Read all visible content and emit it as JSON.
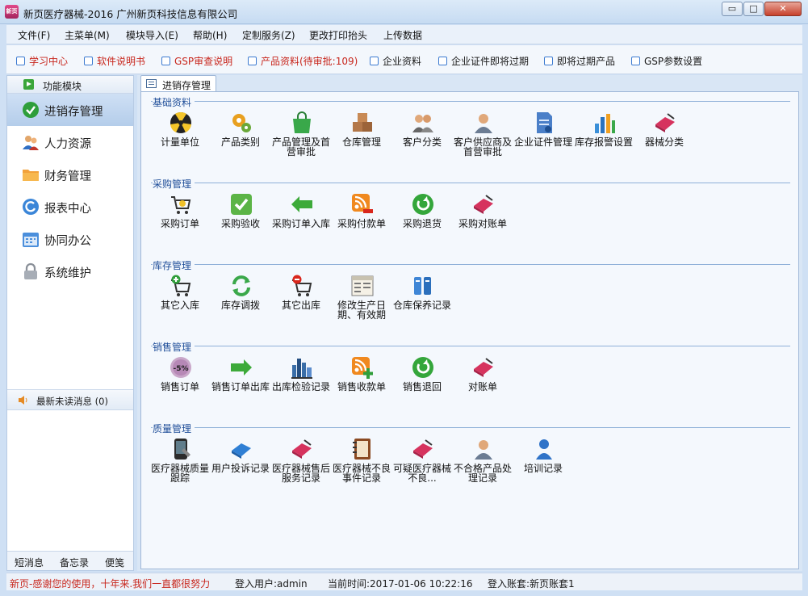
{
  "window": {
    "app_icon_text": "新页",
    "title": "新页医疗器械-2016 广州新页科技信息有限公司",
    "min_glyph": "▭",
    "max_glyph": "□",
    "close_glyph": "✕"
  },
  "menu": [
    "文件(F)",
    "主菜单(M)",
    "模块导入(E)",
    "帮助(H)",
    "定制服务(Z)",
    "更改打印抬头",
    "上传数据"
  ],
  "quickbar": [
    {
      "label": "学习中心",
      "color": "#c8261c"
    },
    {
      "label": "软件说明书",
      "color": "#c8261c"
    },
    {
      "label": "GSP审查说明",
      "color": "#c8261c"
    },
    {
      "label": "产品资料(待审批:109)",
      "color": "#c8261c"
    },
    {
      "label": "企业资料",
      "color": "#1a1a1a"
    },
    {
      "label": "企业证件即将过期",
      "color": "#1a1a1a"
    },
    {
      "label": "即将过期产品",
      "color": "#1a1a1a"
    },
    {
      "label": "GSP参数设置",
      "color": "#1a1a1a"
    }
  ],
  "sidebar": {
    "header": "功能模块",
    "items": [
      {
        "label": "进销存管理",
        "icon": "check-circle-icon",
        "active": true
      },
      {
        "label": "人力资源",
        "icon": "people-icon",
        "active": false
      },
      {
        "label": "财务管理",
        "icon": "folder-icon",
        "active": false
      },
      {
        "label": "报表中心",
        "icon": "refresh-e-icon",
        "active": false
      },
      {
        "label": "协同办公",
        "icon": "calendar-icon",
        "active": false
      },
      {
        "label": "系统维护",
        "icon": "lock-icon",
        "active": false
      }
    ],
    "messages": "最新未读消息 (0)",
    "footer": [
      "短消息",
      "备忘录",
      "便笺"
    ]
  },
  "tab": {
    "label": "进销存管理"
  },
  "sections": [
    {
      "title": "基础资料",
      "items": [
        {
          "label": "计量单位",
          "icon": "radiation-icon"
        },
        {
          "label": "产品类别",
          "icon": "gears-icon"
        },
        {
          "label": "产品管理及首营审批",
          "icon": "shopping-bag-icon"
        },
        {
          "label": "仓库管理",
          "icon": "boxes-icon"
        },
        {
          "label": "客户分类",
          "icon": "users-icon"
        },
        {
          "label": "客户供应商及首营审批",
          "icon": "user-icon"
        },
        {
          "label": "企业证件管理",
          "icon": "document-icon"
        },
        {
          "label": "库存报警设置",
          "icon": "bar-chart-icon"
        },
        {
          "label": "器械分类",
          "icon": "book-icon"
        }
      ]
    },
    {
      "title": "采购管理",
      "items": [
        {
          "label": "采购订单",
          "icon": "cart-star-icon"
        },
        {
          "label": "采购验收",
          "icon": "checkmark-icon"
        },
        {
          "label": "采购订单入库",
          "icon": "arrow-left-icon"
        },
        {
          "label": "采购付款单",
          "icon": "rss-minus-icon"
        },
        {
          "label": "采购退货",
          "icon": "return-icon"
        },
        {
          "label": "采购对账单",
          "icon": "book-icon"
        }
      ]
    },
    {
      "title": "库存管理",
      "items": [
        {
          "label": "其它入库",
          "icon": "cart-add-icon"
        },
        {
          "label": "库存调拨",
          "icon": "sync-icon"
        },
        {
          "label": "其它出库",
          "icon": "cart-remove-icon"
        },
        {
          "label": "修改生产日期、有效期",
          "icon": "form-icon"
        },
        {
          "label": "仓库保养记录",
          "icon": "binder-icon"
        }
      ]
    },
    {
      "title": "销售管理",
      "items": [
        {
          "label": "销售订单",
          "icon": "discount-icon"
        },
        {
          "label": "销售订单出库",
          "icon": "arrow-right-icon"
        },
        {
          "label": "出库检验记录",
          "icon": "skyline-icon"
        },
        {
          "label": "销售收款单",
          "icon": "rss-plus-icon"
        },
        {
          "label": "销售退回",
          "icon": "return-icon"
        },
        {
          "label": "对账单",
          "icon": "book-icon"
        }
      ]
    },
    {
      "title": "质量管理",
      "items": [
        {
          "label": "医疗器械质量跟踪",
          "icon": "phone-icon"
        },
        {
          "label": "用户投诉记录",
          "icon": "book-blue-icon"
        },
        {
          "label": "医疗器械售后服务记录",
          "icon": "book-icon"
        },
        {
          "label": "医疗器械不良事件记录",
          "icon": "notebook-icon"
        },
        {
          "label": "可疑医疗器械不良...",
          "icon": "book-icon"
        },
        {
          "label": "不合格产品处理记录",
          "icon": "user-icon"
        },
        {
          "label": "培训记录",
          "icon": "person-icon"
        }
      ]
    }
  ],
  "statusbar": {
    "slogan": "新页-感谢您的使用，十年来.我们一直都很努力",
    "user": "登入用户:admin",
    "time": "当前时间:2017-01-06 10:22:16",
    "account": "登入账套:新页账套1"
  }
}
